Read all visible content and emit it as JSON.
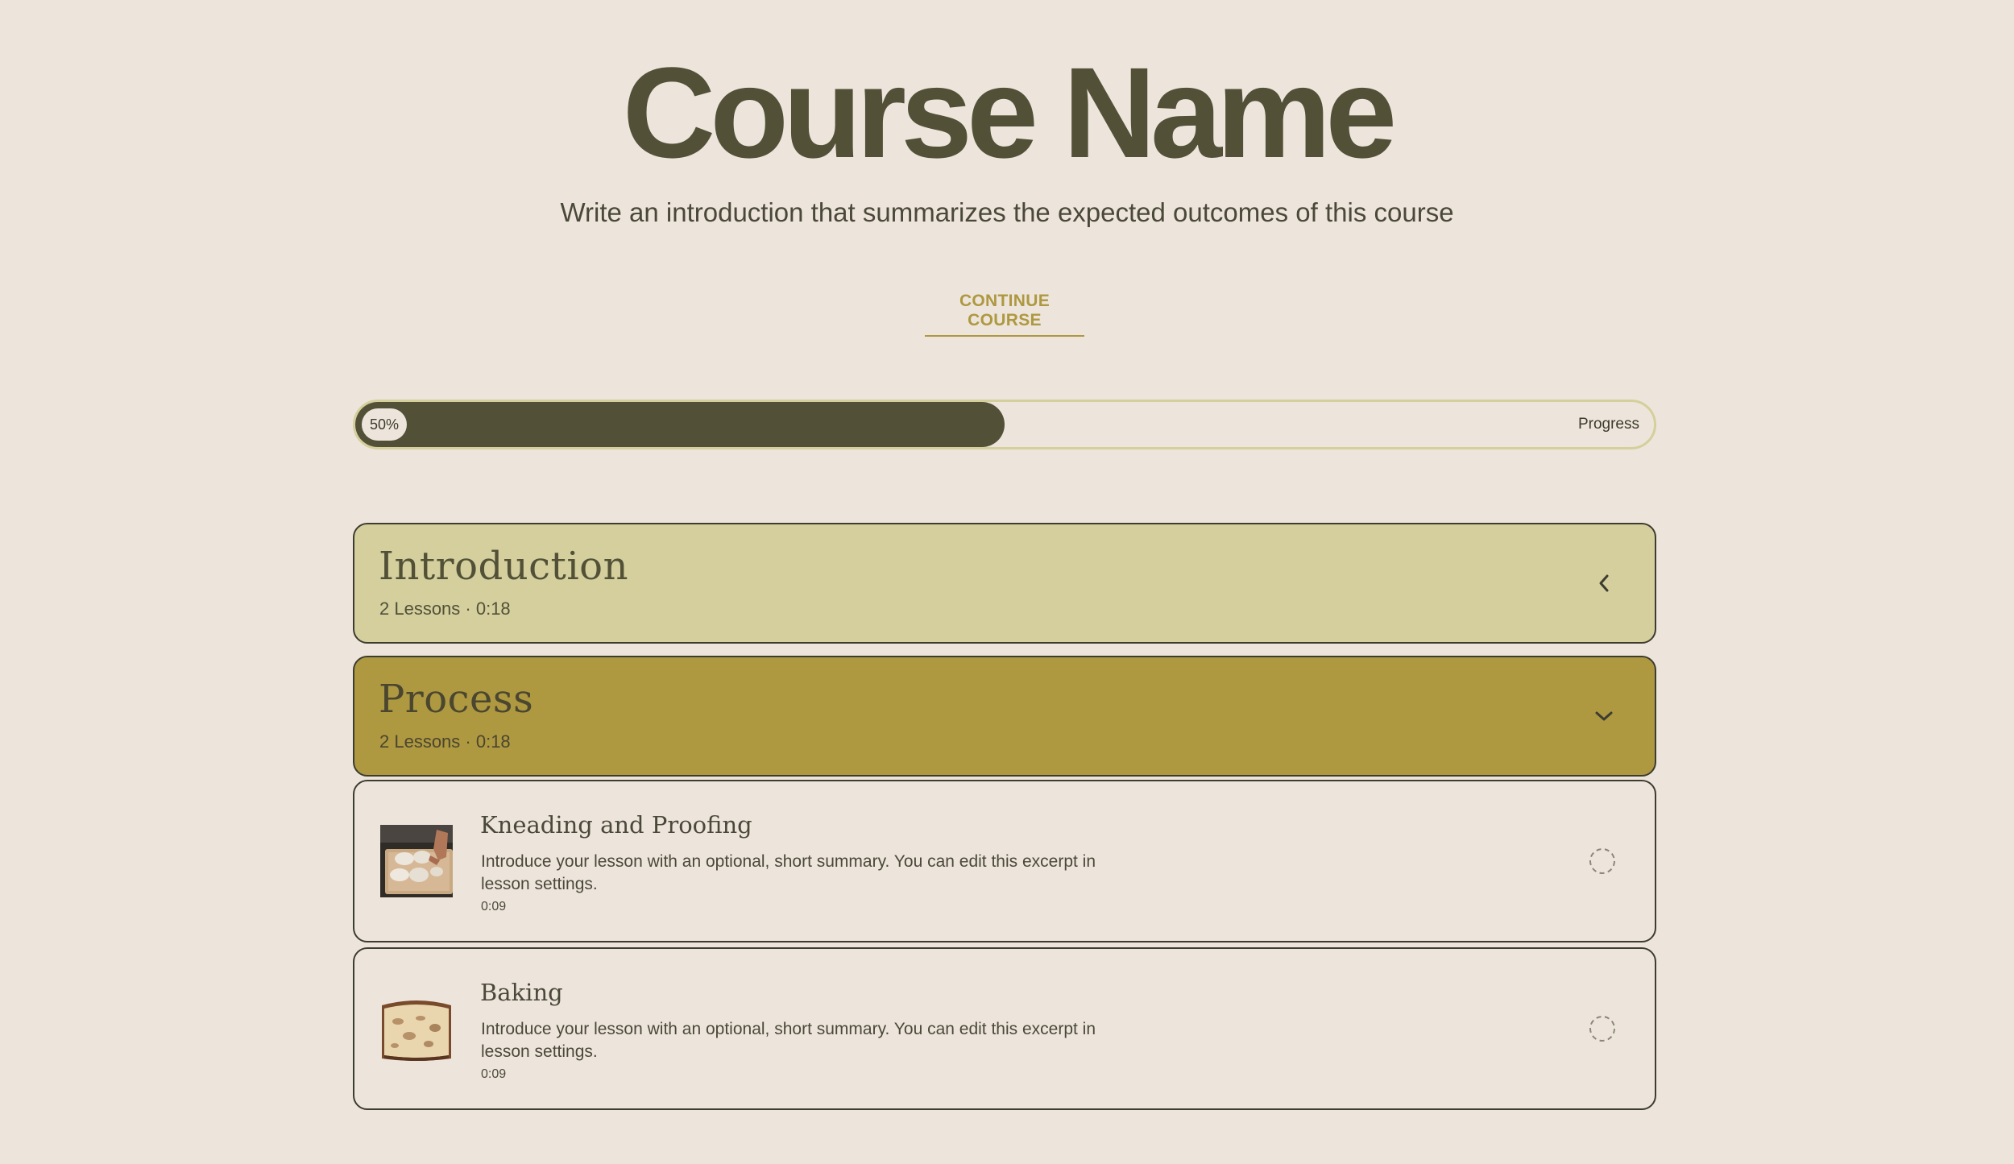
{
  "hero": {
    "title": "Course Name",
    "intro": "Write an introduction that summarizes the expected outcomes of this course",
    "continue_label": "CONTINUE COURSE"
  },
  "progress": {
    "value_label": "50%",
    "value_fraction": 0.5,
    "label": "Progress"
  },
  "modules": [
    {
      "title": "Introduction",
      "meta": "2 Lessons · 0:18",
      "expanded": false,
      "chevron_icon": "chevron-left-icon",
      "color": "#d4cf9d"
    },
    {
      "title": "Process",
      "meta": "2 Lessons · 0:18",
      "expanded": true,
      "chevron_icon": "chevron-down-icon",
      "color": "#ae9840"
    }
  ],
  "lessons": [
    {
      "title": "Kneading and Proofing",
      "summary": "Introduce your lesson with an optional, short summary. You can edit this excerpt in lesson settings.",
      "duration": "0:09",
      "thumbnail_icon": "dough-image",
      "status_icon": "incomplete-circle-icon"
    },
    {
      "title": "Baking",
      "summary": "Introduce your lesson with an optional, short summary. You can edit this excerpt in lesson settings.",
      "duration": "0:09",
      "thumbnail_icon": "bread-image",
      "status_icon": "incomplete-circle-icon"
    }
  ],
  "colors": {
    "background": "#ede5dc",
    "text_dark": "#525138",
    "accent_gold": "#ae9840",
    "accent_light": "#d4cf9d"
  }
}
